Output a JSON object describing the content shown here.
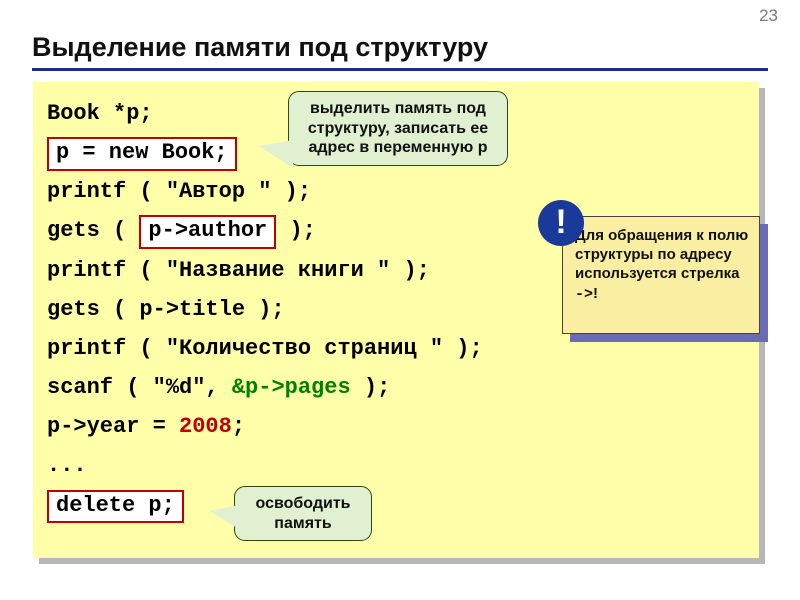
{
  "page_number": "23",
  "title": "Выделение памяти под структуру",
  "code": {
    "l1": "Book *p;",
    "l2_hl": "p = new Book;",
    "l3": "printf ( \"Автор \" );",
    "l4a": "gets ( ",
    "l4_hl": "p->author",
    "l4b": " );",
    "l5": "printf ( \"Название книги \" );",
    "l6": "gets ( p->title );",
    "l7": "printf ( \"Количество страниц \" );",
    "l8a": "scanf ( \"%d\", ",
    "l8b": "&p->pages",
    "l8c": " );",
    "l9a": "p->year = ",
    "l9_num": "2008",
    "l9b": ";",
    "l10": "...",
    "l11_hl": "delete p;"
  },
  "callout1": "выделить память под структуру, записать ее адрес в переменную p",
  "callout2": "освободить память",
  "note": {
    "text1": "Для обращения к полю структуры по адресу используется стрелка ",
    "arrow": "->",
    "text2": "!"
  },
  "excl": "!"
}
